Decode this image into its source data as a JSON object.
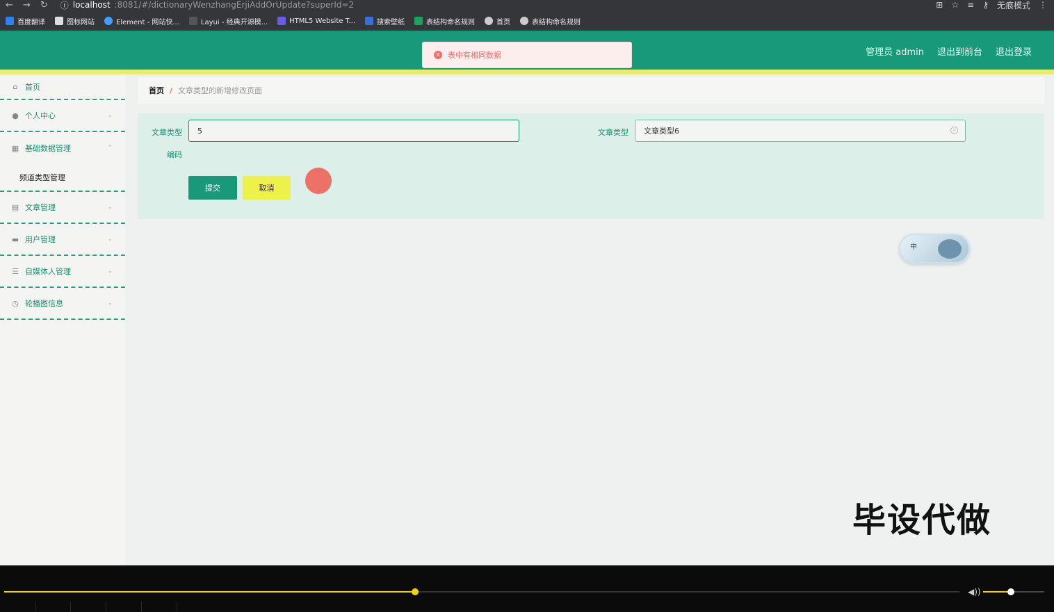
{
  "browser": {
    "url_host": "localhost",
    "url_path": ":8081/#/dictionaryWenzhangErjiAddOrUpdate?superId=2",
    "profile_label": "无痕模式",
    "bookmarks": [
      "百度翻译",
      "图标网站",
      "Element - 网站快...",
      "Layui - 经典开源模...",
      "HTML5 Website T...",
      "搜索壁纸",
      "表结构命名规则",
      "首页",
      "表结构命名规则"
    ]
  },
  "toast": {
    "message": "表中有相同数据"
  },
  "header": {
    "admin_label": "管理员 admin",
    "back_front": "退出到前台",
    "logout": "退出登录"
  },
  "sidebar": {
    "items": [
      {
        "label": "首页",
        "icon": "home-icon"
      },
      {
        "label": "个人中心",
        "icon": "user-icon"
      },
      {
        "label": "基础数据管理",
        "icon": "grid-icon"
      },
      {
        "label": "频道类型管理"
      },
      {
        "label": "文章管理",
        "icon": "document-icon"
      },
      {
        "label": "用户管理",
        "icon": "monitor-icon"
      },
      {
        "label": "自媒体人管理",
        "icon": "list-icon"
      },
      {
        "label": "轮播图信息",
        "icon": "clock-icon"
      }
    ]
  },
  "breadcrumb": {
    "home": "首页",
    "sep": "/",
    "current": "文章类型的新增修改页面"
  },
  "form": {
    "code_label_1": "文章类型",
    "code_label_2": "编码",
    "code_value": "5",
    "name_label": "文章类型",
    "name_value": "文章类型6",
    "submit": "提交",
    "cancel": "取消"
  },
  "ime": {
    "label": "中"
  },
  "watermark": "毕设代做",
  "player": {
    "progress": 0.43,
    "volume": 0.45
  }
}
